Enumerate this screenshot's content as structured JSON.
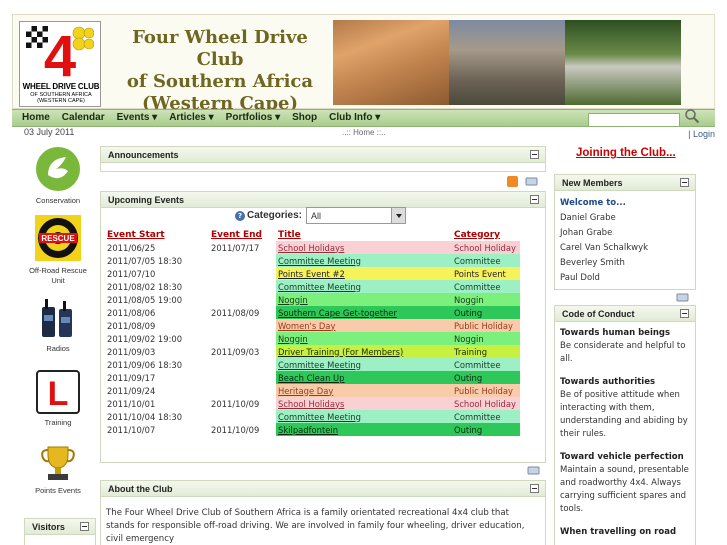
{
  "site": {
    "title_line1": "Four Wheel Drive Club",
    "title_line2": "of Southern Africa",
    "title_line3": "(Western Cape)",
    "logo_line1": "WHEEL DRIVE CLUB",
    "logo_line2": "OF SOUTHERN AFRICA",
    "logo_line3": "(WESTERN CAPE)",
    "logo_digit": "4"
  },
  "nav": {
    "items": [
      "Home",
      "Calendar",
      "Events ▾",
      "Articles ▾",
      "Portfolios ▾",
      "Shop",
      "Club Info ▾"
    ],
    "search_placeholder": ""
  },
  "subbar": {
    "date": "03 July 2011",
    "breadcrumb": "..:: Home ::..",
    "login": "| Login"
  },
  "left": {
    "items": [
      "Conservation",
      "Off-Road Rescue Unit",
      "Radios",
      "Training",
      "Points Events"
    ],
    "visitors_title": "Visitors"
  },
  "announcements": {
    "title": "Announcements"
  },
  "upcoming": {
    "title": "Upcoming Events",
    "categories_label": "Categories:",
    "categories_value": "All",
    "headers": [
      "Event Start",
      "Event End",
      "Title",
      "Category"
    ],
    "rows": [
      {
        "start": "2011/06/25",
        "end": "2011/07/17",
        "title": "School Holidays",
        "category": "School Holiday",
        "color": "#f9d0d4",
        "tcolor": "#9a2a3a"
      },
      {
        "start": "2011/07/05 18:30",
        "end": "",
        "title": "Committee Meeting",
        "category": "Committee",
        "color": "#9cf0c4",
        "tcolor": "#1a3a2a"
      },
      {
        "start": "2011/07/10",
        "end": "",
        "title": "Points Event #2",
        "category": "Points Event",
        "color": "#f6f25a",
        "tcolor": "#222"
      },
      {
        "start": "2011/08/02 18:30",
        "end": "",
        "title": "Committee Meeting",
        "category": "Committee",
        "color": "#9cf0c4",
        "tcolor": "#1a3a2a"
      },
      {
        "start": "2011/08/05 19:00",
        "end": "",
        "title": "Noggin",
        "category": "Noggin",
        "color": "#7cf07c",
        "tcolor": "#1a3a1a"
      },
      {
        "start": "2011/08/06",
        "end": "2011/08/09",
        "title": "Southern Cape Get-together",
        "category": "Outing",
        "color": "#2ec85a",
        "tcolor": "#0a2a10"
      },
      {
        "start": "2011/08/09",
        "end": "",
        "title": "Women's Day",
        "category": "Public Holiday",
        "color": "#f8ccaa",
        "tcolor": "#9a3a1a"
      },
      {
        "start": "2011/09/02 19:00",
        "end": "",
        "title": "Noggin",
        "category": "Noggin",
        "color": "#7cf07c",
        "tcolor": "#1a3a1a"
      },
      {
        "start": "2011/09/03",
        "end": "2011/09/03",
        "title": "Driver Training (For Members)",
        "category": "Training",
        "color": "#c8f040",
        "tcolor": "#1a2a00"
      },
      {
        "start": "2011/09/06 18:30",
        "end": "",
        "title": "Committee Meeting",
        "category": "Committee",
        "color": "#9cf0c4",
        "tcolor": "#1a3a2a"
      },
      {
        "start": "2011/09/17",
        "end": "",
        "title": "Beach Clean Up",
        "category": "Outing",
        "color": "#2ec85a",
        "tcolor": "#0a2a10"
      },
      {
        "start": "2011/09/24",
        "end": "",
        "title": "Heritage Day",
        "category": "Public Holiday",
        "color": "#f8ccaa",
        "tcolor": "#9a3a1a"
      },
      {
        "start": "2011/10/01",
        "end": "2011/10/09",
        "title": "School Holidays",
        "category": "School Holiday",
        "color": "#f9d0d4",
        "tcolor": "#9a2a3a"
      },
      {
        "start": "2011/10/04 18:30",
        "end": "",
        "title": "Committee Meeting",
        "category": "Committee",
        "color": "#9cf0c4",
        "tcolor": "#1a3a2a"
      },
      {
        "start": "2011/10/07",
        "end": "2011/10/09",
        "title": "Skilpadfontein",
        "category": "Outing",
        "color": "#2ec85a",
        "tcolor": "#0a2a10"
      }
    ]
  },
  "about": {
    "title": "About the Club",
    "text": "The Four Wheel Drive Club of Southern Africa is a family orientated recreational 4x4 club that stands for responsible off-road driving.  We are involved in family four wheeling, driver education, civil emergency"
  },
  "right": {
    "join_label": "Joining the Club...",
    "members_title": "New Members",
    "welcome": "Welcome to...",
    "members": [
      "Daniel Grabe",
      "Johan Grabe",
      "Carel Van Schalkwyk",
      "Beverley Smith",
      "Paul Dold"
    ],
    "coc_title": "Code of Conduct",
    "coc": [
      {
        "head": "Towards human beings",
        "body": "Be considerate and helpful to all."
      },
      {
        "head": "Towards authorities",
        "body": "Be of positive attitude when interacting with them, understanding and abiding by their rules."
      },
      {
        "head": "Toward vehicle perfection",
        "body": "Maintain a sound, presentable and roadworthy 4x4. Always carrying sufficient spares and tools."
      },
      {
        "head": "When travelling on road",
        "body": ""
      }
    ]
  }
}
